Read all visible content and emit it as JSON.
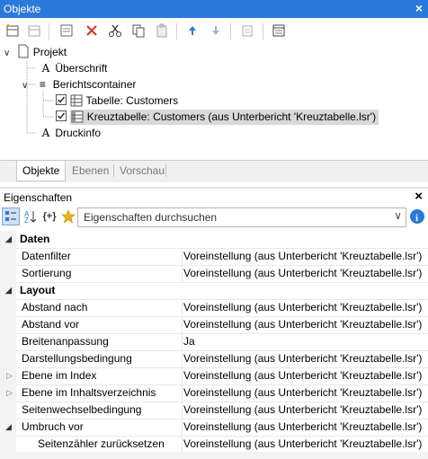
{
  "window": {
    "title": "Objekte",
    "close": "×"
  },
  "tree": {
    "nodes": [
      {
        "label": "Projekt"
      },
      {
        "label": "Überschrift",
        "glyph": "A"
      },
      {
        "label": "Berichtscontainer",
        "glyph": "≡"
      },
      {
        "label": "Tabelle: Customers",
        "checked": true
      },
      {
        "label": "Kreuztabelle: Customers (aus Unterbericht 'Kreuztabelle.lsr')",
        "checked": true,
        "selected": true
      },
      {
        "label": "Druckinfo",
        "glyph": "A"
      }
    ]
  },
  "tabs": [
    "Objekte",
    "Ebenen",
    "Vorschau"
  ],
  "properties_panel": {
    "title": "Eigenschaften",
    "close": "×",
    "search_placeholder": "Eigenschaften durchsuchen",
    "brace_label": "{+}"
  },
  "grid": [
    {
      "type": "cat",
      "name": "Daten",
      "expanded": true
    },
    {
      "name": "Datenfilter",
      "value": "Voreinstellung (aus Unterbericht 'Kreuztabelle.lsr')"
    },
    {
      "name": "Sortierung",
      "value": "Voreinstellung (aus Unterbericht 'Kreuztabelle.lsr')"
    },
    {
      "type": "cat",
      "name": "Layout",
      "expanded": true
    },
    {
      "name": "Abstand nach",
      "value": "Voreinstellung (aus Unterbericht 'Kreuztabelle.lsr')"
    },
    {
      "name": "Abstand vor",
      "value": "Voreinstellung (aus Unterbericht 'Kreuztabelle.lsr')"
    },
    {
      "name": "Breitenanpassung",
      "value": "Ja"
    },
    {
      "name": "Darstellungsbedingung",
      "value": "Voreinstellung (aus Unterbericht 'Kreuztabelle.lsr')"
    },
    {
      "name": "Ebene im Index",
      "value": "Voreinstellung (aus Unterbericht 'Kreuztabelle.lsr')",
      "collapsed": true
    },
    {
      "name": "Ebene im Inhaltsverzeichnis",
      "value": "Voreinstellung (aus Unterbericht 'Kreuztabelle.lsr')",
      "collapsed": true
    },
    {
      "name": "Seitenwechselbedingung",
      "value": "Voreinstellung (aus Unterbericht 'Kreuztabelle.lsr')"
    },
    {
      "name": "Umbruch vor",
      "value": "Voreinstellung (aus Unterbericht 'Kreuztabelle.lsr')",
      "expanded": true
    },
    {
      "name": "Seitenzähler zurücksetzen",
      "value": "Voreinstellung (aus Unterbericht 'Kreuztabelle.lsr')",
      "sub": true
    }
  ],
  "colors": {
    "titlebar": "#2b79d8",
    "selected": "#d9d9d9",
    "delete": "#d83a2a",
    "arrow": "#2b79d8"
  }
}
